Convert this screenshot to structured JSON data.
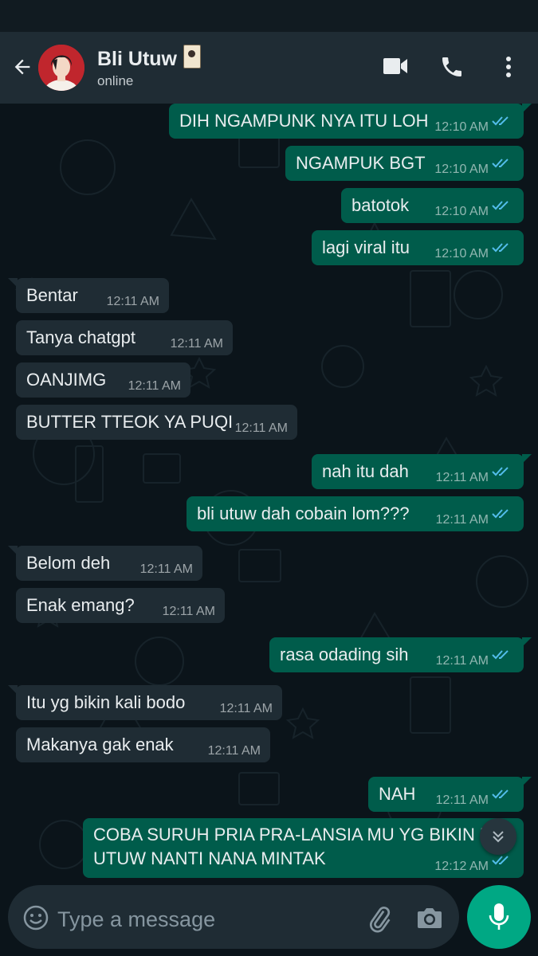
{
  "header": {
    "name": "Bli Utuw",
    "status": "online"
  },
  "messages": [
    {
      "dir": "out",
      "text": "DIH NGAMPUNK NYA ITU LOH",
      "time": "12:10 AM"
    },
    {
      "dir": "out",
      "text": "NGAMPUK BGT",
      "time": "12:10 AM"
    },
    {
      "dir": "out",
      "text": "batotok",
      "time": "12:10 AM"
    },
    {
      "dir": "out",
      "text": "lagi viral itu",
      "time": "12:10 AM"
    },
    {
      "dir": "in",
      "text": "Bentar",
      "time": "12:11 AM"
    },
    {
      "dir": "in",
      "text": "Tanya chatgpt",
      "time": "12:11 AM"
    },
    {
      "dir": "in",
      "text": "OANJIMG",
      "time": "12:11 AM"
    },
    {
      "dir": "in",
      "text": "BUTTER TTEOK YA PUQI",
      "time": "12:11 AM"
    },
    {
      "dir": "out",
      "text": "nah itu dah",
      "time": "12:11 AM"
    },
    {
      "dir": "out",
      "text": "bli utuw dah cobain lom???",
      "time": "12:11 AM"
    },
    {
      "dir": "in",
      "text": "Belom deh",
      "time": "12:11 AM"
    },
    {
      "dir": "in",
      "text": "Enak emang?",
      "time": "12:11 AM"
    },
    {
      "dir": "out",
      "text": "rasa odading sih",
      "time": "12:11 AM"
    },
    {
      "dir": "in",
      "text": "Itu yg bikin kali bodo",
      "time": "12:11 AM"
    },
    {
      "dir": "in",
      "text": "Makanya gak enak",
      "time": "12:11 AM"
    },
    {
      "dir": "out",
      "text": "NAH",
      "time": "12:11 AM"
    },
    {
      "dir": "out",
      "lines": [
        "COBA SURUH PRIA PRA-LANSIA MU YG BIKIN BLI",
        "UTUW NANTI NANA MINTAK"
      ],
      "time": "12:12 AM"
    }
  ],
  "composer": {
    "placeholder": "Type a message"
  },
  "icons": {
    "back": "arrow-left-icon",
    "video": "video-camera-icon",
    "call": "phone-icon",
    "menu": "more-vertical-icon",
    "emoji": "emoji-icon",
    "attach": "paperclip-icon",
    "camera": "camera-icon",
    "mic": "microphone-icon",
    "scroll": "chevron-double-down-icon",
    "read_receipt": "double-check-icon"
  },
  "colors": {
    "outgoing": "#005c4b",
    "incoming": "#1f2c34",
    "header": "#1f2c34",
    "background": "#0b141a",
    "accent": "#00a884",
    "read_tick": "#53bdeb"
  }
}
